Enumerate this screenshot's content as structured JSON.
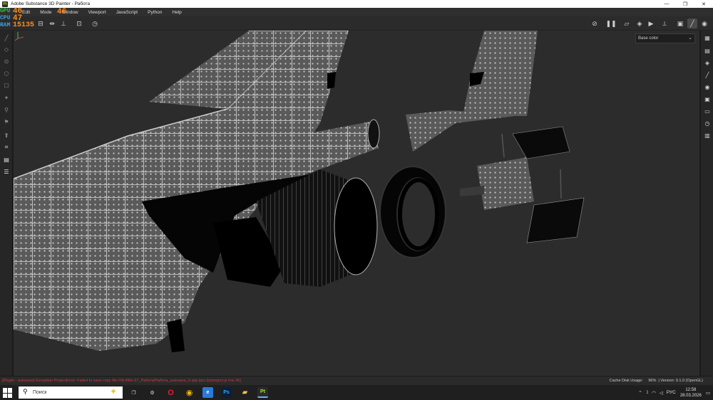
{
  "window": {
    "title": "Adobe Substance 3D Painter - Работа",
    "app_icon": "Pt",
    "controls": [
      "minimize-icon",
      "restore-icon",
      "close-icon"
    ]
  },
  "menu": [
    "Edit",
    "Mode",
    "Window",
    "Viewport",
    "JavaScript",
    "Python",
    "Help"
  ],
  "perf": [
    {
      "label": "GPU",
      "value": "46",
      "unit": "°C",
      "color": "#2fbf3f"
    },
    {
      "label": "CPU",
      "value": "47",
      "unit": "°C",
      "color": "#3fa0e0"
    },
    {
      "label": "RAM",
      "value": "15135",
      "unit": "MB",
      "color": "#3fa0e0"
    }
  ],
  "perf_extra": {
    "value": "46",
    "unit": "°C"
  },
  "toolbar": {
    "left_icons": [
      "symmetry-icon",
      "mirror-icon",
      "align-icon",
      "frame-icon",
      "history-icon"
    ],
    "right_icons": [
      "visibility-off-icon",
      "pause-icon",
      "folder-icon",
      "cube-icon",
      "camera-video-icon",
      "axis-icon",
      "box-3d-icon",
      "brush-icon",
      "screenshot-icon"
    ]
  },
  "viewport": {
    "channel": "Base color",
    "background": "#2c2c2c"
  },
  "left_tools": [
    "paint-brush-icon",
    "eraser-icon",
    "projection-icon",
    "geometry-mask-icon",
    "smudge-icon",
    "clone-icon",
    "material-picker-icon",
    "bake-icon",
    "export-icon",
    "layer-icon",
    "document-icon",
    "mesh-icon"
  ],
  "right_dock": [
    "layers-panel-icon",
    "texture-set-icon",
    "stack-icon",
    "properties-icon",
    "display-icon",
    "camera-icon",
    "shelf-icon",
    "history-panel-icon",
    "log-icon"
  ],
  "status": {
    "error": "[Plugin - autosave] Exception ProjectError: Failed to save copy file:///A:/Миг-27_Работа/Работа_autosave_0.spp [qrc:/js/project.js line 36]",
    "cache_label": "Cache Disk Usage:",
    "cache_value": "96%",
    "version": "| Version: 9.1.0 (OpenGL)"
  },
  "taskbar": {
    "search_placeholder": "Поиск",
    "apps": [
      "task-view-icon",
      "settings-icon",
      "opera-icon",
      "chrome-icon",
      "edge-icon",
      "photoshop-icon",
      "file-explorer-icon",
      "substance-painter-icon"
    ],
    "tray_lang": "РУС",
    "time": "12:58",
    "date": "28.03.2026"
  }
}
